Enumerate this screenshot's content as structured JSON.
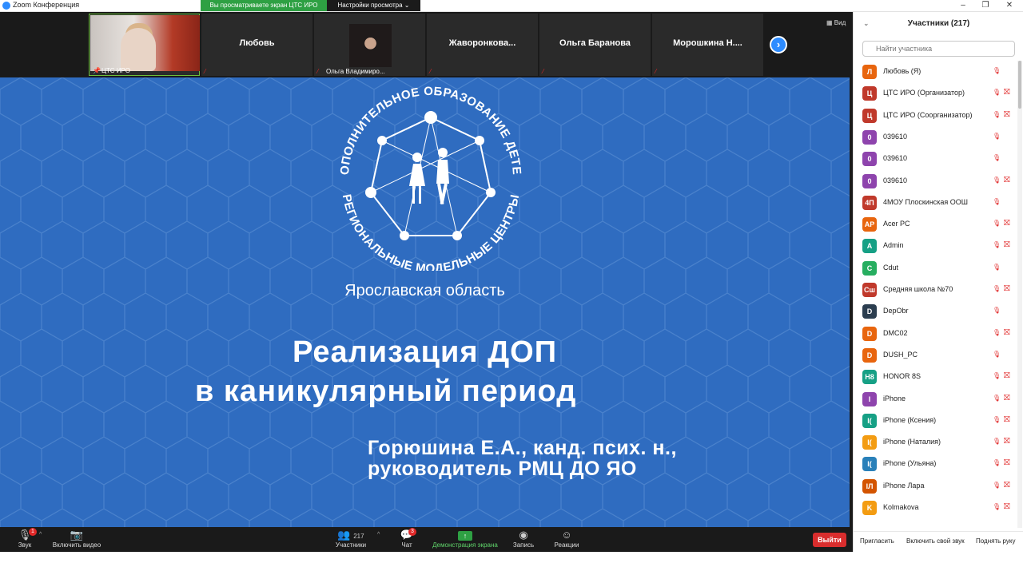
{
  "titlebar": {
    "app_title": "Zoom Конференция",
    "share_banner": "Вы просматриваете экран ЦТС ИРО",
    "view_options": "Настройки просмотра ⌄"
  },
  "thumbs": {
    "view_label": "Вид",
    "items": [
      {
        "name": "",
        "footer": "ЦТС ИРО"
      },
      {
        "name": "Любовь",
        "footer": ""
      },
      {
        "name": "",
        "footer": "Ольга Владимиро..."
      },
      {
        "name": "Жаворонкова...",
        "footer": ""
      },
      {
        "name": "Ольга Баранова",
        "footer": ""
      },
      {
        "name": "Морошкина  Н....",
        "footer": ""
      }
    ]
  },
  "slide": {
    "logo_top_text": "ДОПОЛНИТЕЛЬНОЕ ОБРАЗОВАНИЕ ДЕТЕЙ",
    "logo_bottom_text": "РЕГИОНАЛЬНЫЕ МОДЕЛЬНЫЕ ЦЕНТРЫ",
    "region": "Ярославская область",
    "title_line1": "Реализация ДОП",
    "title_line2": "в каникулярный период",
    "author_line1": "Горюшина Е.А., канд. псих. н.,",
    "author_line2": "руководитель РМЦ ДО ЯО"
  },
  "toolbar": {
    "audio": "Звук",
    "audio_badge": "1",
    "video": "Включить видео",
    "participants": "Участники",
    "participants_count": "217",
    "chat": "Чат",
    "chat_badge": "3",
    "share": "Демонстрация экрана",
    "record": "Запись",
    "reactions": "Реакции",
    "leave": "Выйти"
  },
  "panel": {
    "title": "Участники (217)",
    "search_placeholder": "Найти участника",
    "participants": [
      {
        "initials": "Л",
        "name": "Любовь (Я)",
        "color": "#e8650e"
      },
      {
        "initials": "Ц",
        "name": "ЦТС ИРО (Организатор)",
        "color": "#c0392b"
      },
      {
        "initials": "Ц",
        "name": "ЦТС ИРО (Соорганизатор)",
        "color": "#c0392b"
      },
      {
        "initials": "0",
        "name": "039610",
        "color": "#8e44ad"
      },
      {
        "initials": "0",
        "name": "039610",
        "color": "#8e44ad"
      },
      {
        "initials": "0",
        "name": "039610",
        "color": "#8e44ad"
      },
      {
        "initials": "4П",
        "name": "4МОУ Плоскинская ООШ",
        "color": "#c0392b"
      },
      {
        "initials": "AP",
        "name": "Acer PC",
        "color": "#e8650e"
      },
      {
        "initials": "A",
        "name": "Admin",
        "color": "#16a085"
      },
      {
        "initials": "C",
        "name": "Cdut",
        "color": "#27ae60"
      },
      {
        "initials": "Сш",
        "name": "Средняя школа №70",
        "color": "#c0392b"
      },
      {
        "initials": "D",
        "name": "DepObr",
        "color": "#2c3e50"
      },
      {
        "initials": "D",
        "name": "DMC02",
        "color": "#e8650e"
      },
      {
        "initials": "D",
        "name": "DUSH_PC",
        "color": "#e8650e"
      },
      {
        "initials": "H8",
        "name": "HONOR 8S",
        "color": "#16a085"
      },
      {
        "initials": "I",
        "name": "iPhone",
        "color": "#8e44ad"
      },
      {
        "initials": "I(",
        "name": "iPhone (Ксения)",
        "color": "#16a085"
      },
      {
        "initials": "I(",
        "name": "iPhone (Наталия)",
        "color": "#f39c12"
      },
      {
        "initials": "I(",
        "name": "iPhone (Ульяна)",
        "color": "#2980b9"
      },
      {
        "initials": "IЛ",
        "name": "iPhone Лара",
        "color": "#d35400"
      },
      {
        "initials": "K",
        "name": "Kolmakova",
        "color": "#f39c12"
      }
    ],
    "invite": "Пригласить",
    "unmute_me": "Включить свой звук",
    "raise_hand": "Поднять руку"
  }
}
